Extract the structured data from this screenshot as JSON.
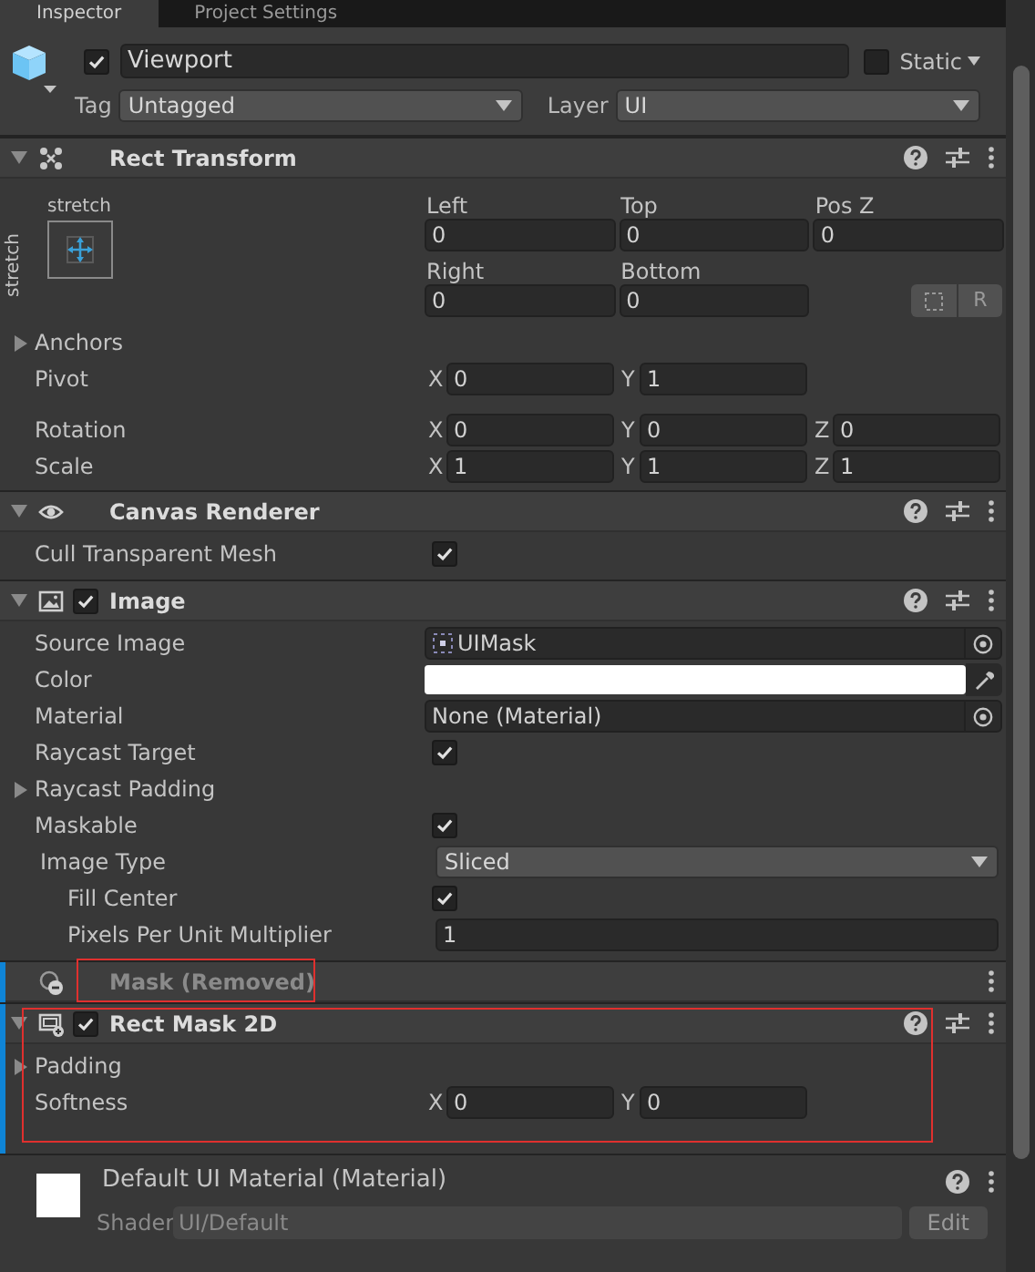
{
  "tabs": [
    {
      "label": "Inspector",
      "selected": true
    },
    {
      "label": "Project Settings",
      "selected": false
    }
  ],
  "object": {
    "active": true,
    "name": "Viewport",
    "static_label": "Static",
    "static": false,
    "tag_label": "Tag",
    "tag": "Untagged",
    "layer_label": "Layer",
    "layer": "UI"
  },
  "components": [
    {
      "kind": "rect_transform",
      "title": "Rect Transform",
      "expanded": true,
      "highlighted": false,
      "modified": false,
      "anchor_preset": {
        "top_label": "stretch",
        "side_label": "stretch"
      },
      "fields": [
        {
          "label": "Left",
          "value": "0"
        },
        {
          "label": "Top",
          "value": "0"
        },
        {
          "label": "Pos Z",
          "value": "0"
        },
        {
          "label": "Right",
          "value": "0"
        },
        {
          "label": "Bottom",
          "value": "0"
        }
      ],
      "raw_button": "R",
      "rows": [
        {
          "kind": "foldout",
          "label": "Anchors",
          "expanded": false
        },
        {
          "kind": "vector",
          "label": "Pivot",
          "axes": [
            {
              "axis": "X",
              "value": "0"
            },
            {
              "axis": "Y",
              "value": "1"
            }
          ]
        },
        {
          "kind": "vector",
          "label": "Rotation",
          "axes": [
            {
              "axis": "X",
              "value": "0"
            },
            {
              "axis": "Y",
              "value": "0"
            },
            {
              "axis": "Z",
              "value": "0"
            }
          ]
        },
        {
          "kind": "vector",
          "label": "Scale",
          "axes": [
            {
              "axis": "X",
              "value": "1"
            },
            {
              "axis": "Y",
              "value": "1"
            },
            {
              "axis": "Z",
              "value": "1"
            }
          ]
        }
      ]
    },
    {
      "kind": "canvas_renderer",
      "title": "Canvas Renderer",
      "expanded": true,
      "highlighted": false,
      "modified": false,
      "rows": [
        {
          "kind": "checkbox",
          "label": "Cull Transparent Mesh",
          "checked": true
        }
      ]
    },
    {
      "kind": "image",
      "title": "Image",
      "expanded": true,
      "enabled": true,
      "highlighted": false,
      "modified": false,
      "rows": [
        {
          "kind": "object",
          "label": "Source Image",
          "value": "UIMask",
          "sprite": true
        },
        {
          "kind": "color",
          "label": "Color",
          "color": "#ffffff"
        },
        {
          "kind": "object",
          "label": "Material",
          "value": "None (Material)",
          "sprite": false
        },
        {
          "kind": "checkbox",
          "label": "Raycast Target",
          "checked": true
        },
        {
          "kind": "foldout",
          "label": "Raycast Padding",
          "expanded": false
        },
        {
          "kind": "checkbox",
          "label": "Maskable",
          "checked": true
        },
        {
          "kind": "dropdown",
          "label": "Image Type",
          "value": "Sliced",
          "children": [
            {
              "kind": "checkbox",
              "label": "Fill Center",
              "checked": true
            },
            {
              "kind": "number",
              "label": "Pixels Per Unit Multiplier",
              "value": "1"
            }
          ]
        }
      ]
    },
    {
      "kind": "removed",
      "title": "Mask (Removed)",
      "highlighted": true,
      "modified": true
    },
    {
      "kind": "rect_mask",
      "title": "Rect Mask 2D",
      "expanded": true,
      "enabled": true,
      "highlighted": true,
      "modified": true,
      "rows": [
        {
          "kind": "foldout",
          "label": "Padding",
          "expanded": false
        },
        {
          "kind": "vector",
          "label": "Softness",
          "axes": [
            {
              "axis": "X",
              "value": "0"
            },
            {
              "axis": "Y",
              "value": "0"
            }
          ]
        }
      ]
    },
    {
      "kind": "material",
      "title": "Default UI Material (Material)",
      "shader_label": "Shader",
      "shader": "UI/Default",
      "edit_button": "Edit",
      "highlighted": false,
      "modified": false
    }
  ]
}
